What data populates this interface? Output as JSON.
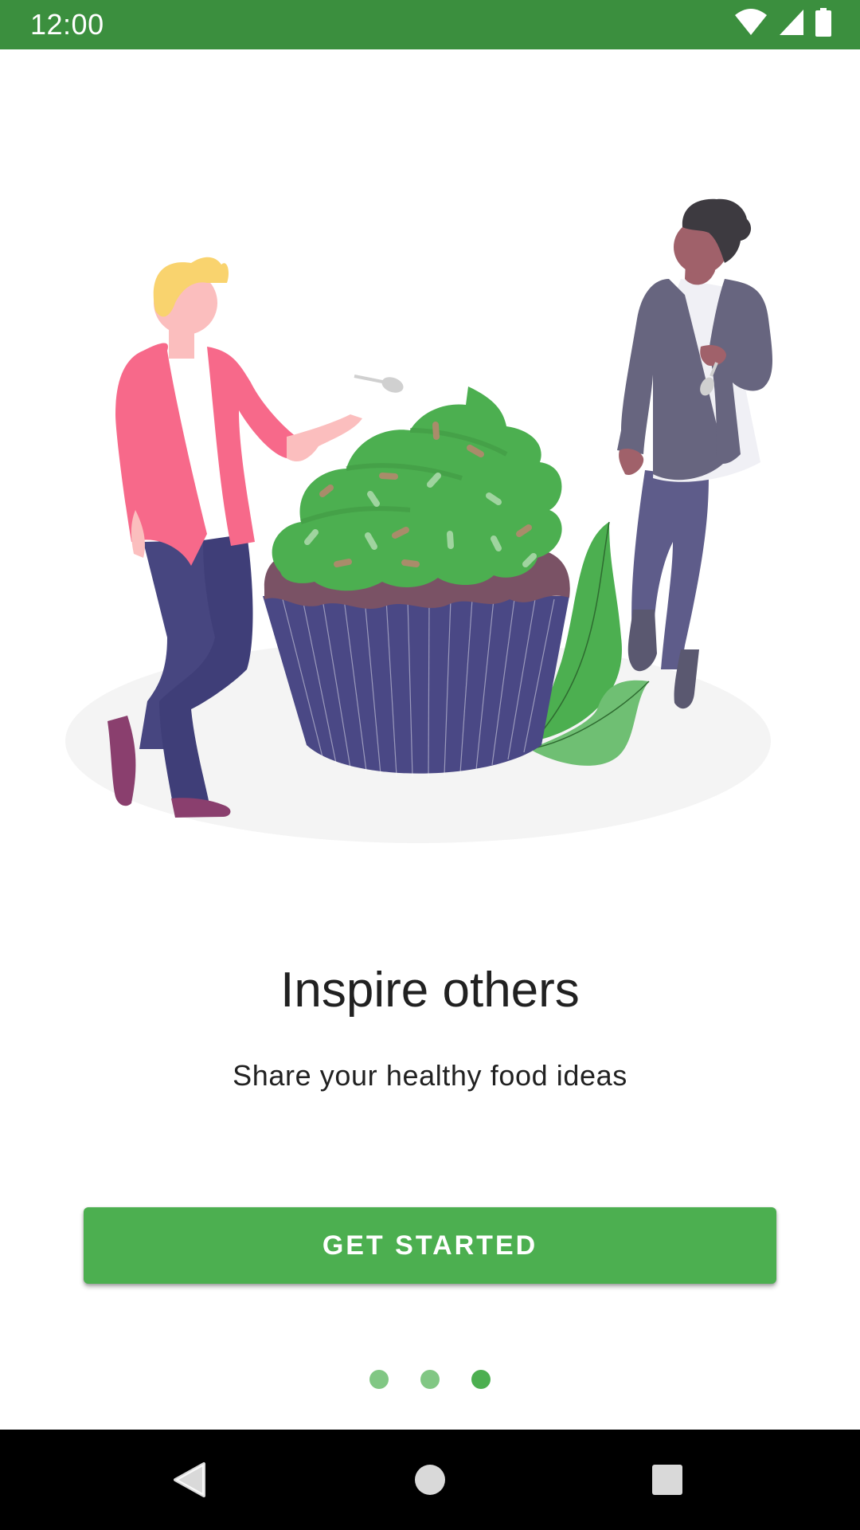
{
  "status_bar": {
    "time": "12:00",
    "color": "#3b8f3e",
    "icons": [
      "wifi-icon",
      "cellular-signal-icon",
      "battery-icon"
    ]
  },
  "onboarding": {
    "title": "Inspire others",
    "subtitle": "Share your healthy food ideas",
    "button_label": "GET STARTED",
    "page_indicator": {
      "total_pages": 3,
      "current_page": 3
    }
  },
  "colors": {
    "accent": "#4caf50",
    "dot_inactive": "#81c784"
  },
  "nav_bar": {
    "icons": [
      "back-icon",
      "home-icon",
      "recents-icon"
    ]
  }
}
